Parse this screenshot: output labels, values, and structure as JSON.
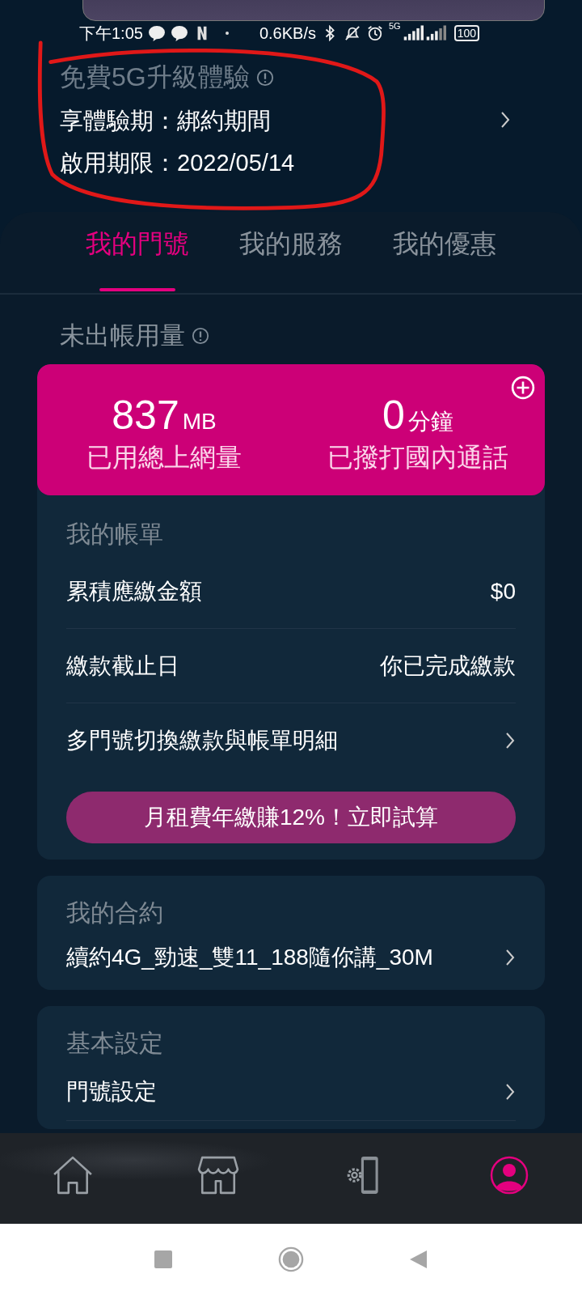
{
  "status_bar": {
    "time": "下午1:05",
    "speed": "0.6KB/s",
    "network": "5G",
    "battery": "100"
  },
  "promo": {
    "title": "免費5G升級體驗",
    "lines": [
      "享體驗期：綁約期間",
      "啟用期限：2022/05/14"
    ]
  },
  "tabs": [
    {
      "label": "我的門號",
      "selected": true
    },
    {
      "label": "我的服務",
      "selected": false
    },
    {
      "label": "我的優惠",
      "selected": false
    }
  ],
  "usage": {
    "title": "未出帳用量",
    "stats": [
      {
        "value": "837",
        "unit": "MB",
        "label": "已用總上網量"
      },
      {
        "value": "0",
        "unit": "分鐘",
        "label": "已撥打國內通話"
      }
    ]
  },
  "bill": {
    "title": "我的帳單",
    "rows": [
      {
        "label": "累積應繳金額",
        "value": "$0",
        "kind": "value"
      },
      {
        "label": "繳款截止日",
        "value": "你已完成繳款",
        "kind": "value"
      },
      {
        "label": "多門號切換繳款與帳單明細",
        "kind": "link"
      }
    ],
    "button": "月租費年繳賺12%！立即試算"
  },
  "contract": {
    "title": "我的合約",
    "plan": "續約4G_勁速_雙11_188隨你講_30M"
  },
  "settings": {
    "title": "基本設定",
    "rows": [
      {
        "label": "門號設定"
      }
    ]
  },
  "bottom_nav": [
    {
      "kind": "home",
      "selected": false
    },
    {
      "kind": "store",
      "selected": false
    },
    {
      "kind": "device",
      "selected": false
    },
    {
      "kind": "profile",
      "selected": true
    }
  ]
}
